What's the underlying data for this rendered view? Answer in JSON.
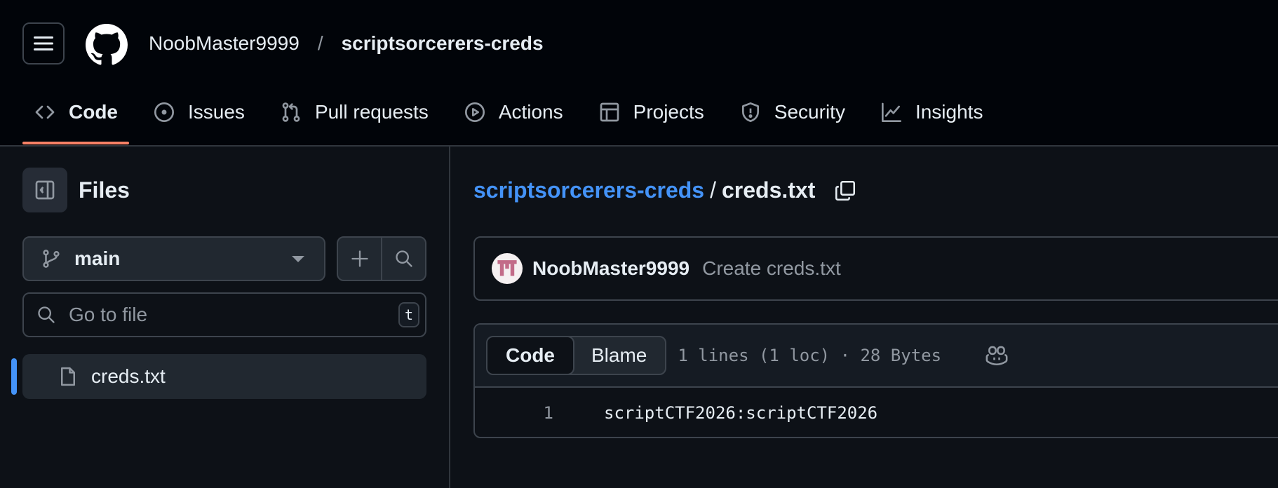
{
  "header": {
    "owner": "NoobMaster9999",
    "separator": "/",
    "repo": "scriptsorcerers-creds",
    "tabs": [
      {
        "label": "Code",
        "icon": "code-icon",
        "active": true
      },
      {
        "label": "Issues",
        "icon": "issue-opened-icon"
      },
      {
        "label": "Pull requests",
        "icon": "git-pull-request-icon"
      },
      {
        "label": "Actions",
        "icon": "play-icon"
      },
      {
        "label": "Projects",
        "icon": "table-icon"
      },
      {
        "label": "Security",
        "icon": "shield-icon"
      },
      {
        "label": "Insights",
        "icon": "graph-icon"
      }
    ]
  },
  "sidebar": {
    "title": "Files",
    "branch": "main",
    "search_placeholder": "Go to file",
    "search_shortcut": "t",
    "files": [
      {
        "name": "creds.txt",
        "selected": true
      }
    ]
  },
  "main": {
    "path_repo": "scriptsorcerers-creds",
    "path_separator": "/",
    "path_file": "creds.txt",
    "commit": {
      "author": "NoobMaster9999",
      "message": "Create creds.txt"
    },
    "code_tab": "Code",
    "blame_tab": "Blame",
    "file_meta": "1 lines (1 loc) · 28 Bytes",
    "lines": [
      {
        "number": "1",
        "text": "scriptCTF2026:scriptCTF2026"
      }
    ]
  },
  "colors": {
    "accent_link": "#4493f8",
    "active_tab_underline": "#f78166",
    "background": "#0d1117",
    "header_background": "#010409"
  }
}
